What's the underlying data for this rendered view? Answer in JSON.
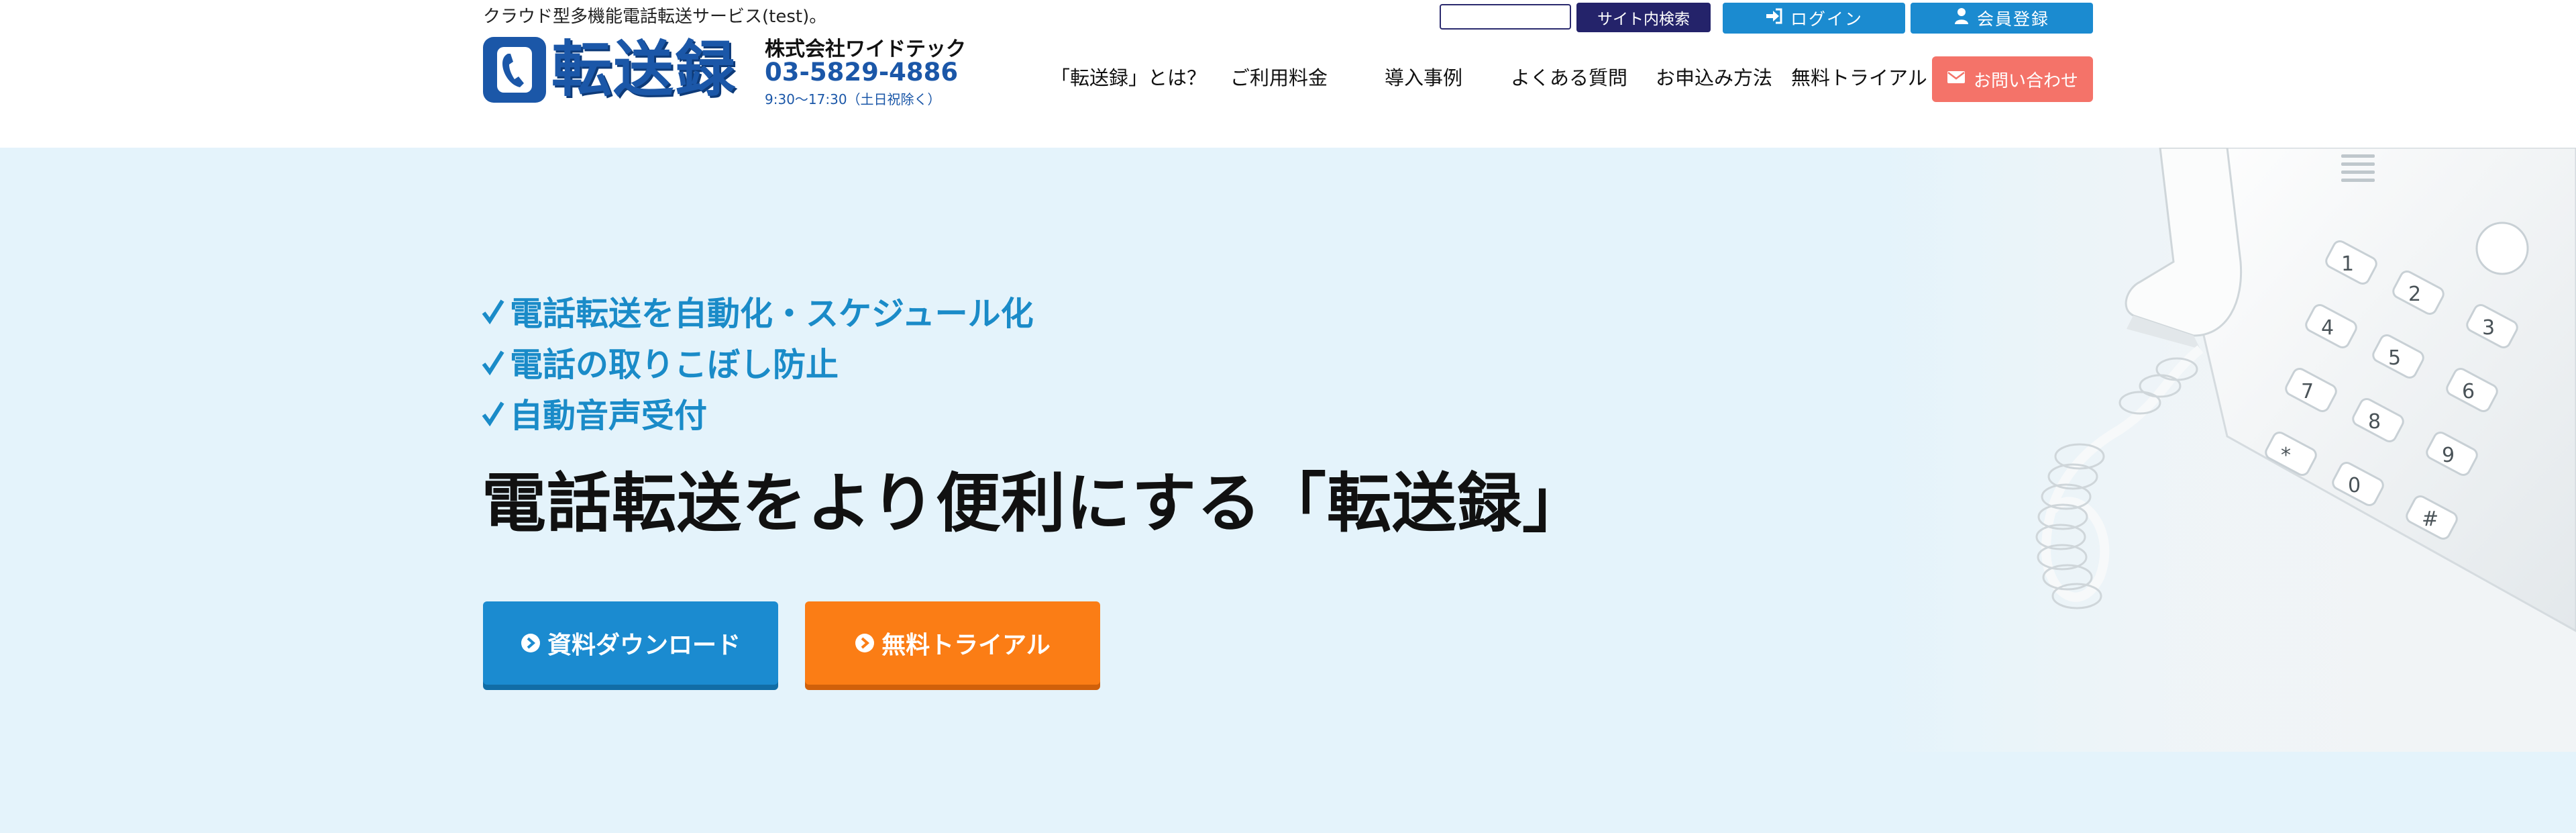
{
  "header": {
    "tagline": "クラウド型多機能電話転送サービス(test)。",
    "logo_text": "転送録",
    "company": "株式会社ワイドテック",
    "phone": "03-5829-4886",
    "hours": "9:30〜17:30（土日祝除く）"
  },
  "search": {
    "placeholder": "",
    "button_label": "サイト内検索"
  },
  "top_buttons": {
    "login": "ログイン",
    "register": "会員登録"
  },
  "nav": {
    "items": [
      "「転送録」とは？",
      "ご利用料金",
      "導入事例",
      "よくある質問",
      "お申込み方法",
      "無料トライアル"
    ],
    "contact": "お問い合わせ"
  },
  "hero": {
    "features": [
      "電話転送を自動化・スケジュール化",
      "電話の取りこぼし防止",
      "自動音声受付"
    ],
    "headline": "電話転送をより便利にする「転送録」",
    "cta_download": "資料ダウンロード",
    "cta_trial": "無料トライアル"
  },
  "colors": {
    "brand_blue": "#1b57a8",
    "accent_blue": "#1b8bd0",
    "navy": "#24236a",
    "contact_red": "#f47369",
    "trial_orange": "#fb7d15",
    "hero_bg": "#e4f3fb"
  },
  "icons": {
    "logo": "phone-handset-icon",
    "login": "sign-in-icon",
    "register": "user-icon",
    "contact": "envelope-icon",
    "download": "chevron-circle-right-icon",
    "trial": "chevron-circle-right-icon",
    "feature": "check-icon"
  }
}
